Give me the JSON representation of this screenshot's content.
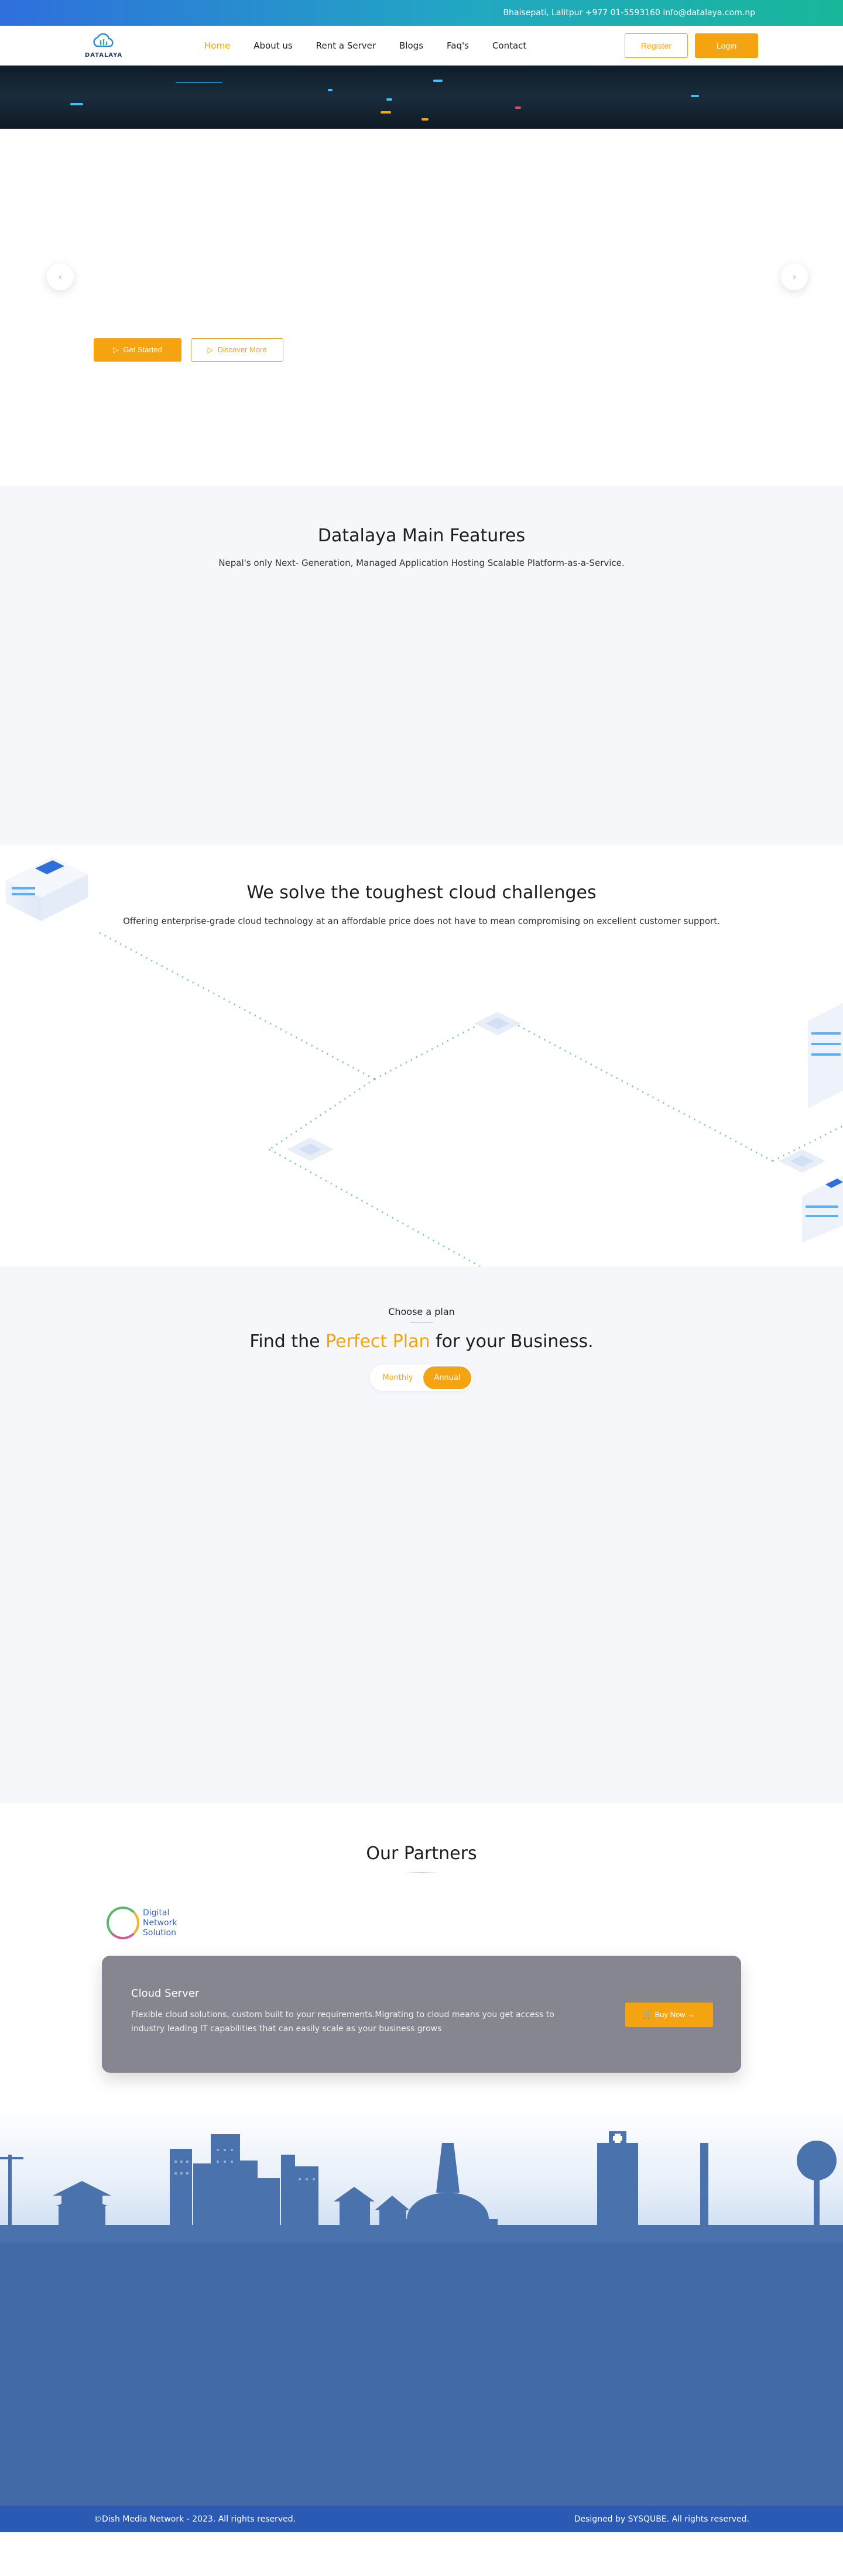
{
  "topbar": {
    "contact": "Bhaisepati, Lalitpur +977 01-5593160 info@datalaya.com.np"
  },
  "brand": {
    "logo_text": "DATALAYA"
  },
  "nav": {
    "home": "Home",
    "about": "About us",
    "rent": "Rent a Server",
    "blogs": "Blogs",
    "faqs": "Faq's",
    "contact": "Contact"
  },
  "auth": {
    "register": "Register",
    "login": "Login"
  },
  "hero": {
    "get_started": "Get Started",
    "discover": "Discover More"
  },
  "features": {
    "title": "Datalaya Main Features",
    "subtitle": "Nepal's only Next- Generation, Managed Application Hosting Scalable Platform-as-a-Service."
  },
  "challenges": {
    "title": "We solve the toughest cloud challenges",
    "subtitle": "Offering enterprise-grade cloud technology at an affordable price does not have to mean compromising on excellent customer support."
  },
  "plans": {
    "kicker": "Choose a plan",
    "title_pre": "Find the ",
    "title_accent": "Perfect Plan",
    "title_post": " for your Business.",
    "monthly": "Monthly",
    "annual": "Annual"
  },
  "partners": {
    "title": "Our Partners",
    "logo_line1": "Digital",
    "logo_line2": "Network",
    "logo_line3": "Solution"
  },
  "cta": {
    "title": "Cloud Server",
    "text": "Flexible cloud solutions, custom built to your requirements.Migrating to cloud means you get access to industry leading IT capabilities that can easily scale as your business grows",
    "button": "Buy Now →"
  },
  "footer": {
    "copyright": "©Dish Media Network - 2023. All rights reserved.",
    "designer": "Designed by SYSQUBE. All rights reserved."
  },
  "colors": {
    "accent": "#f3a410",
    "footer": "#416aa6",
    "copyright_bar": "#2b5ab5"
  }
}
